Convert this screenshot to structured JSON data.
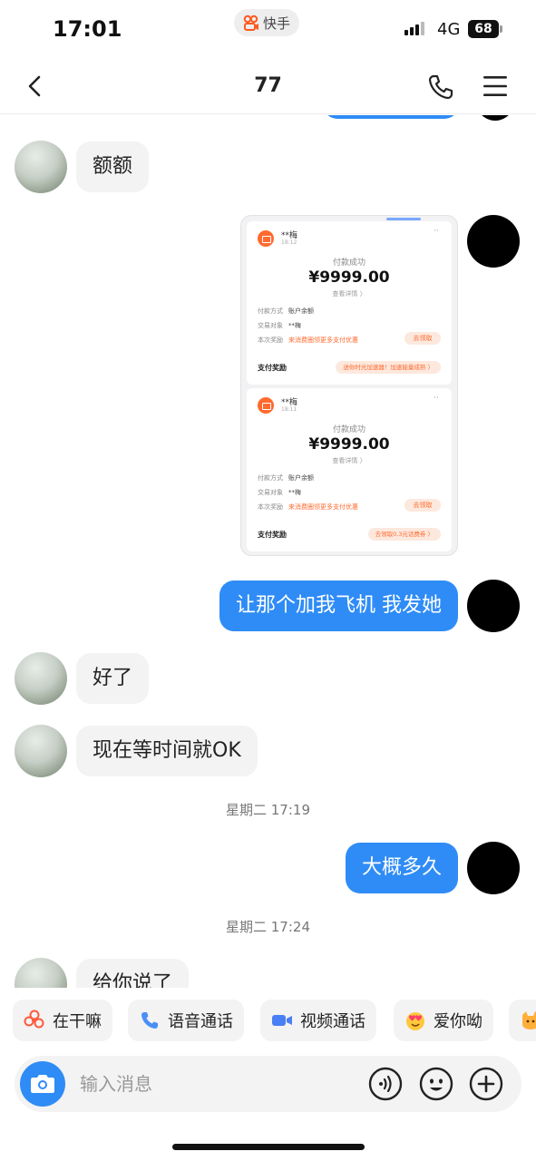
{
  "status_bar": {
    "time": "17:01",
    "app_label": "快手",
    "network": "4G",
    "battery": "68"
  },
  "nav": {
    "title": "77",
    "back_icon": "chevron-left-icon",
    "call_icon": "phone-icon",
    "menu_icon": "menu-icon"
  },
  "messages": [
    {
      "from": "other",
      "text": "额额"
    },
    {
      "from": "me",
      "type": "image",
      "receipts": [
        {
          "name": "**梅",
          "time": "18:12",
          "status": "付款成功",
          "amount": "¥9999.00",
          "detail": "查看详情 〉",
          "rows": [
            {
              "label": "付款方式",
              "value": "账户余额"
            },
            {
              "label": "交易对象",
              "value": "**梅"
            },
            {
              "label": "本次奖励",
              "value": "来消费圈领更多支付优惠"
            }
          ],
          "button": "去领取",
          "reward_label": "支付奖励",
          "reward_text": "送你时光加速器！加速能量成熟 〉"
        },
        {
          "name": "**梅",
          "time": "18:11",
          "status": "付款成功",
          "amount": "¥9999.00",
          "detail": "查看详情 〉",
          "rows": [
            {
              "label": "付款方式",
              "value": "账户余额"
            },
            {
              "label": "交易对象",
              "value": "**梅"
            },
            {
              "label": "本次奖励",
              "value": "来消费圈领更多支付优惠"
            }
          ],
          "button": "去领取",
          "reward_label": "支付奖励",
          "reward_text": "去领取0.3元话费券 〉"
        }
      ]
    },
    {
      "from": "me",
      "text": "让那个加我飞机 我发她"
    },
    {
      "from": "other",
      "text": "好了"
    },
    {
      "from": "other",
      "text": "现在等时间就OK"
    },
    {
      "type": "timestamp",
      "text": "星期二 17:19"
    },
    {
      "from": "me",
      "text": "大概多久"
    },
    {
      "type": "timestamp",
      "text": "星期二 17:24"
    },
    {
      "from": "other",
      "text": "给你说了"
    }
  ],
  "quick_replies": [
    {
      "label": "在干嘛",
      "icon": "flower-icon"
    },
    {
      "label": "语音通话",
      "icon": "phone-icon"
    },
    {
      "label": "视频通话",
      "icon": "video-camera-icon"
    },
    {
      "label": "爱你呦",
      "icon": "heart-eyes-emoji-icon"
    },
    {
      "label": "",
      "icon": "cat-emoji-icon"
    }
  ],
  "input": {
    "placeholder": "输入消息",
    "camera_icon": "camera-icon",
    "voice_icon": "voice-icon",
    "emoji_icon": "smiley-icon",
    "plus_icon": "plus-icon"
  },
  "colors": {
    "accent": "#2f8cf6",
    "bubble_other": "#f3f3f3",
    "kuaishou_orange": "#ff6a2e"
  }
}
